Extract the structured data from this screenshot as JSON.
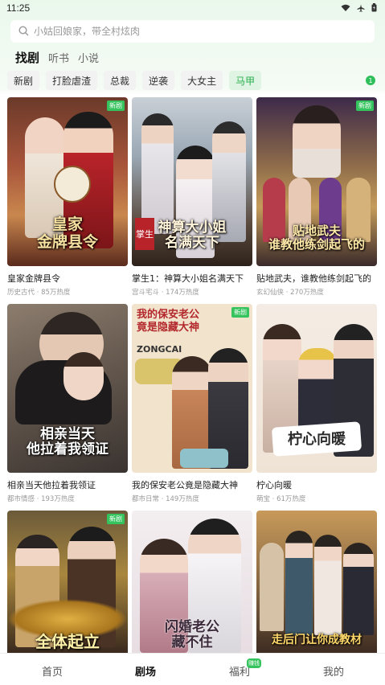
{
  "status_bar": {
    "time": "11:25"
  },
  "search": {
    "placeholder": "小姑回娘家，带全村炫肉"
  },
  "content_tabs": [
    {
      "label": "找剧",
      "active": true
    },
    {
      "label": "听书",
      "active": false
    },
    {
      "label": "小说",
      "active": false
    }
  ],
  "chips": [
    {
      "label": "新剧",
      "active": false
    },
    {
      "label": "打脸虐渣",
      "active": false
    },
    {
      "label": "总裁",
      "active": false
    },
    {
      "label": "逆袭",
      "active": false
    },
    {
      "label": "大女主",
      "active": false
    },
    {
      "label": "马甲",
      "active": true
    }
  ],
  "chip_badge": "1",
  "dramas": [
    {
      "title": "皇家金牌县令",
      "meta": "历史古代 · 85万热度",
      "poster_text": "皇家\n金牌县令",
      "new": "新剧"
    },
    {
      "title": "掌生1：神算大小姐名满天下",
      "meta": "宫斗宅斗 · 174万热度",
      "poster_text": "神算大小姐\n名满天下",
      "new": ""
    },
    {
      "title": "贴地武夫，谁教他练剑起飞的",
      "meta": "玄幻仙侠 · 270万热度",
      "poster_text": "贴地武夫\n谁教他练剑起飞的",
      "new": "新剧"
    },
    {
      "title": "相亲当天他拉着我领证",
      "meta": "都市情感 · 193万热度",
      "poster_text": "相亲当天\n他拉着我领证",
      "new": ""
    },
    {
      "title": "我的保安老公竟是隐藏大神",
      "meta": "都市日常 · 149万热度",
      "poster_text": "我的保安老公\n竟是隐藏大神",
      "new": "新剧"
    },
    {
      "title": "柠心向暖",
      "meta": "萌宝 · 61万热度",
      "poster_text": "柠心向暖",
      "new": ""
    },
    {
      "title": "",
      "meta": "",
      "poster_text": "全体起立",
      "new": "新剧"
    },
    {
      "title": "",
      "meta": "",
      "poster_text": "闪婚老公\n藏不住",
      "new": ""
    },
    {
      "title": "",
      "meta": "",
      "poster_text": "走后门让你成教材",
      "new": ""
    }
  ],
  "bottom_nav": [
    {
      "label": "首页",
      "active": false
    },
    {
      "label": "剧场",
      "active": true
    },
    {
      "label": "福利",
      "active": false
    },
    {
      "label": "我的",
      "active": false
    }
  ],
  "welfare_badge": "赚钱",
  "colors": {
    "accent": "#2ebf5a",
    "chip_active_bg": "#e0f4e3"
  }
}
